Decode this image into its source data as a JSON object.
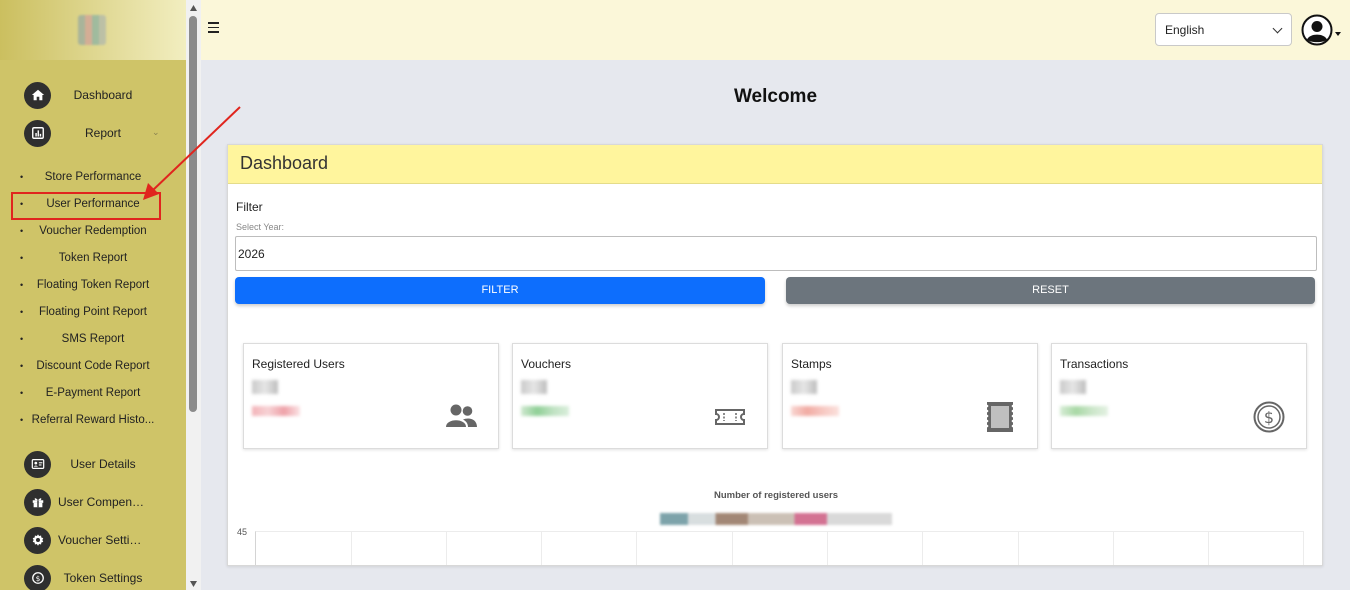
{
  "sidebar": {
    "menu": [
      {
        "label": "Dashboard",
        "icon": "home-icon"
      },
      {
        "label": "Report",
        "icon": "chart-icon"
      }
    ],
    "report_submenu": [
      "Store Performance",
      "User Performance",
      "Voucher Redemption",
      "Token Report",
      "Floating Token Report",
      "Floating Point Report",
      "SMS Report",
      "Discount Code Report",
      "E-Payment Report",
      "Referral Reward Histo..."
    ],
    "menu2": [
      {
        "label": "User Details",
        "icon": "user-card-icon"
      },
      {
        "label": "User Compensa...",
        "icon": "gift-icon"
      },
      {
        "label": "Voucher Settings",
        "icon": "gear-icon"
      },
      {
        "label": "Token Settings",
        "icon": "coin-icon"
      }
    ]
  },
  "topbar": {
    "language": "English"
  },
  "main": {
    "welcome": "Welcome",
    "card_title": "Dashboard",
    "filter_title": "Filter",
    "year_label": "Select Year:",
    "year_value": "2026",
    "filter_button": "FILTER",
    "reset_button": "RESET",
    "stats": [
      {
        "title": "Registered Users",
        "icon": "users-icon"
      },
      {
        "title": "Vouchers",
        "icon": "ticket-icon"
      },
      {
        "title": "Stamps",
        "icon": "stamp-icon"
      },
      {
        "title": "Transactions",
        "icon": "dollar-coin-icon"
      }
    ],
    "chart_title": "Number of registered users",
    "chart_ytick": "45"
  },
  "colors": {
    "sidebar_bg": "#cfc468",
    "topbar_bg": "#fbf7d9",
    "card_header_bg": "#fff59d",
    "filter_btn": "#0d6efd",
    "reset_btn": "#6c757d",
    "annotation_red": "#e0251e"
  }
}
